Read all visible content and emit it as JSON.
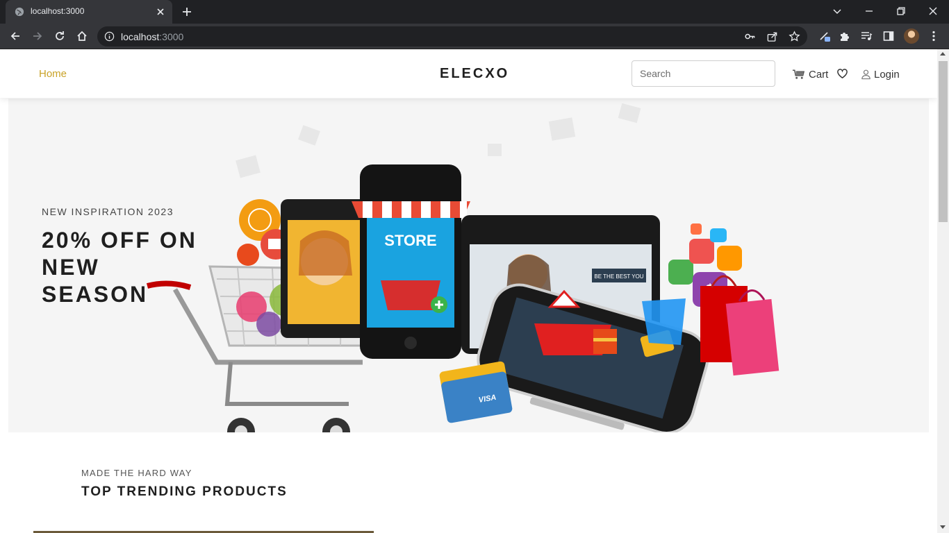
{
  "browser": {
    "tab_title": "localhost:3000",
    "url_host": "localhost",
    "url_port": ":3000"
  },
  "site": {
    "nav_home": "Home",
    "brand": "ELECXO",
    "search_placeholder": "Search",
    "cart_label": "Cart",
    "login_label": "Login"
  },
  "hero": {
    "eyebrow": "NEW INSPIRATION 2023",
    "title": "20% OFF ON NEW SEASON",
    "art_text": {
      "store_sign": "STORE",
      "tablet_banner": "BE THE BEST YOU",
      "card_brand": "VISA",
      "dollar": "$"
    }
  },
  "section": {
    "eyebrow": "MADE THE HARD WAY",
    "title": "TOP TRENDING PRODUCTS"
  },
  "colors": {
    "accent": "#c9a227",
    "chrome_dark": "#202124",
    "chrome_tab": "#35363a",
    "hero_bg": "#f5f5f5"
  },
  "icons": {
    "favicon": "globe-icon",
    "cart": "cart-icon",
    "wishlist": "heart-icon",
    "login": "user-icon"
  }
}
